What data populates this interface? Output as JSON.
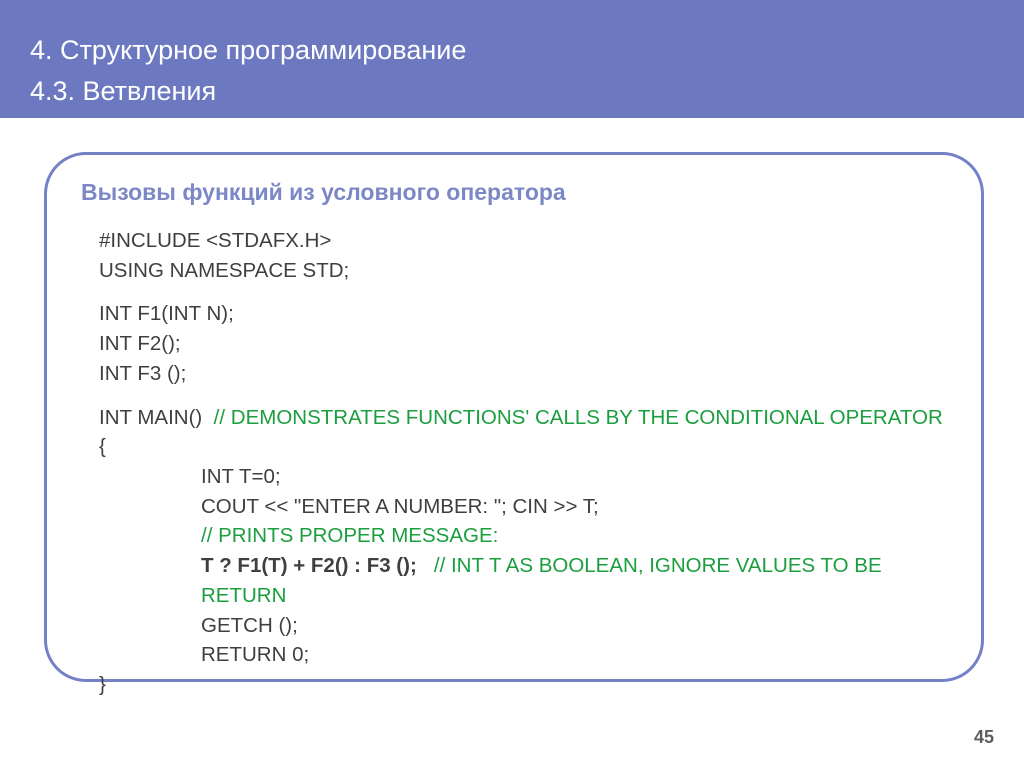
{
  "header": {
    "line1": "4. Структурное программирование",
    "line2": "4.3. Ветвления"
  },
  "section_title": "Вызовы функций из условного оператора",
  "code": {
    "include": "#INCLUDE <STDAFX.H>",
    "using": "USING NAMESPACE STD;",
    "decl1": "INT F1(INT N);",
    "decl2": "INT F2();",
    "decl3": "INT F3 ();",
    "main_sig": "INT MAIN()",
    "main_comment": "// DEMONSTRATES FUNCTIONS' CALLS BY THE CONDITIONAL OPERATOR",
    "brace_open": "{",
    "l1": "INT T=0;",
    "l2": "COUT << \"ENTER A NUMBER: \"; CIN >> T;",
    "l3_comment": "// PRINTS PROPER MESSAGE:",
    "l4_code": "T ? F1(T) + F2() : F3 ();",
    "l4_comment": "// INT T AS BOOLEAN, IGNORE VALUES TO BE RETURN",
    "l5": "GETCH ();",
    "l6": "RETURN 0;",
    "brace_close": "}"
  },
  "page_number": "45"
}
